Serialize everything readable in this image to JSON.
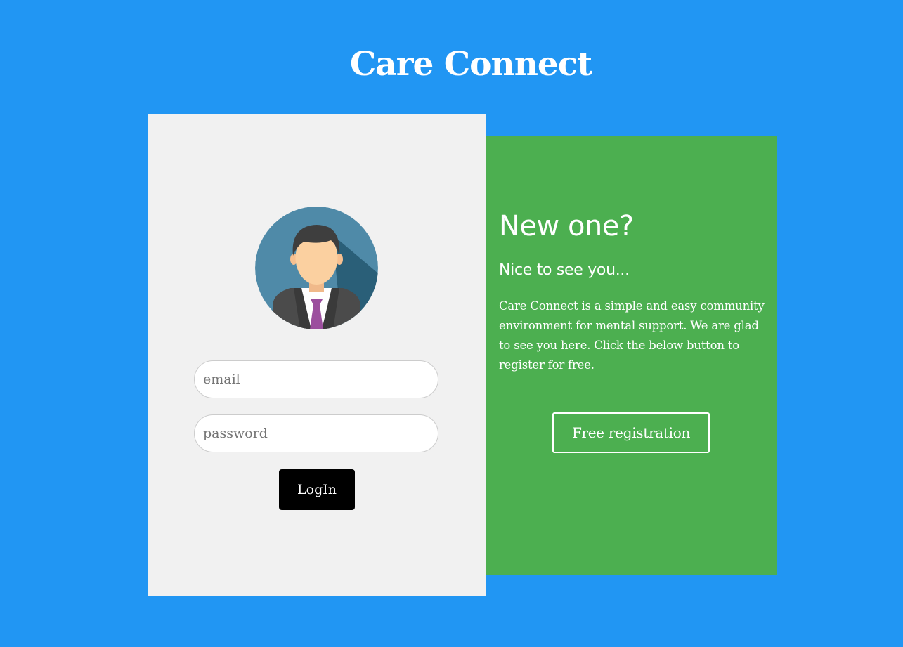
{
  "app": {
    "title": "Care Connect"
  },
  "login": {
    "email_placeholder": "email",
    "password_placeholder": "password",
    "button_label": "LogIn",
    "avatar_icon": "user-avatar-icon"
  },
  "register": {
    "heading": "New one?",
    "subheading": "Nice to see you...",
    "description": "Care Connect is a simple and easy community environment for mental support. We are glad to see you here. Click the below button to register for free.",
    "button_label": "Free registration"
  },
  "colors": {
    "page_background": "#2196f3",
    "login_panel": "#f1f1f1",
    "register_panel": "#4caf50",
    "login_button": "#000000",
    "tie": "#9c4f9e"
  }
}
